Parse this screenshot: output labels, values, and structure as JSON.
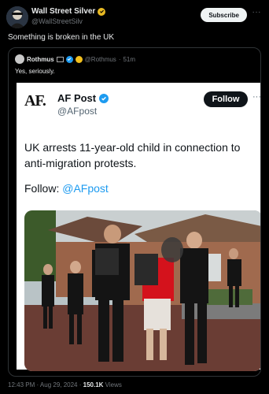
{
  "author": {
    "name": "Wall Street Silver",
    "handle": "@WallStreetSilv",
    "subscribe_label": "Subscribe",
    "more_label": "···"
  },
  "tweet": {
    "text": "Something is broken in the UK"
  },
  "quote": {
    "name": "Rothmus",
    "handle": "@Rothmus",
    "separator": "·",
    "time": "51m",
    "text": "Yes, seriously."
  },
  "card": {
    "logo": "AF.",
    "name": "AF Post",
    "handle": "@AFpost",
    "follow_label": "Follow",
    "more_label": "···",
    "headline": "UK arrests 11-year-old child in connection to anti-migration protests.",
    "follow_prefix": "Follow: ",
    "follow_link": "@AFpost"
  },
  "footer": {
    "time": "12:43 PM · Aug 29, 2024 · ",
    "views_count": "150.1K",
    "views_label": " Views"
  },
  "colors": {
    "background": "#000000",
    "verified_blue": "#1d9bf0",
    "gold_badge": "#e8b923",
    "muted": "#71767b"
  }
}
